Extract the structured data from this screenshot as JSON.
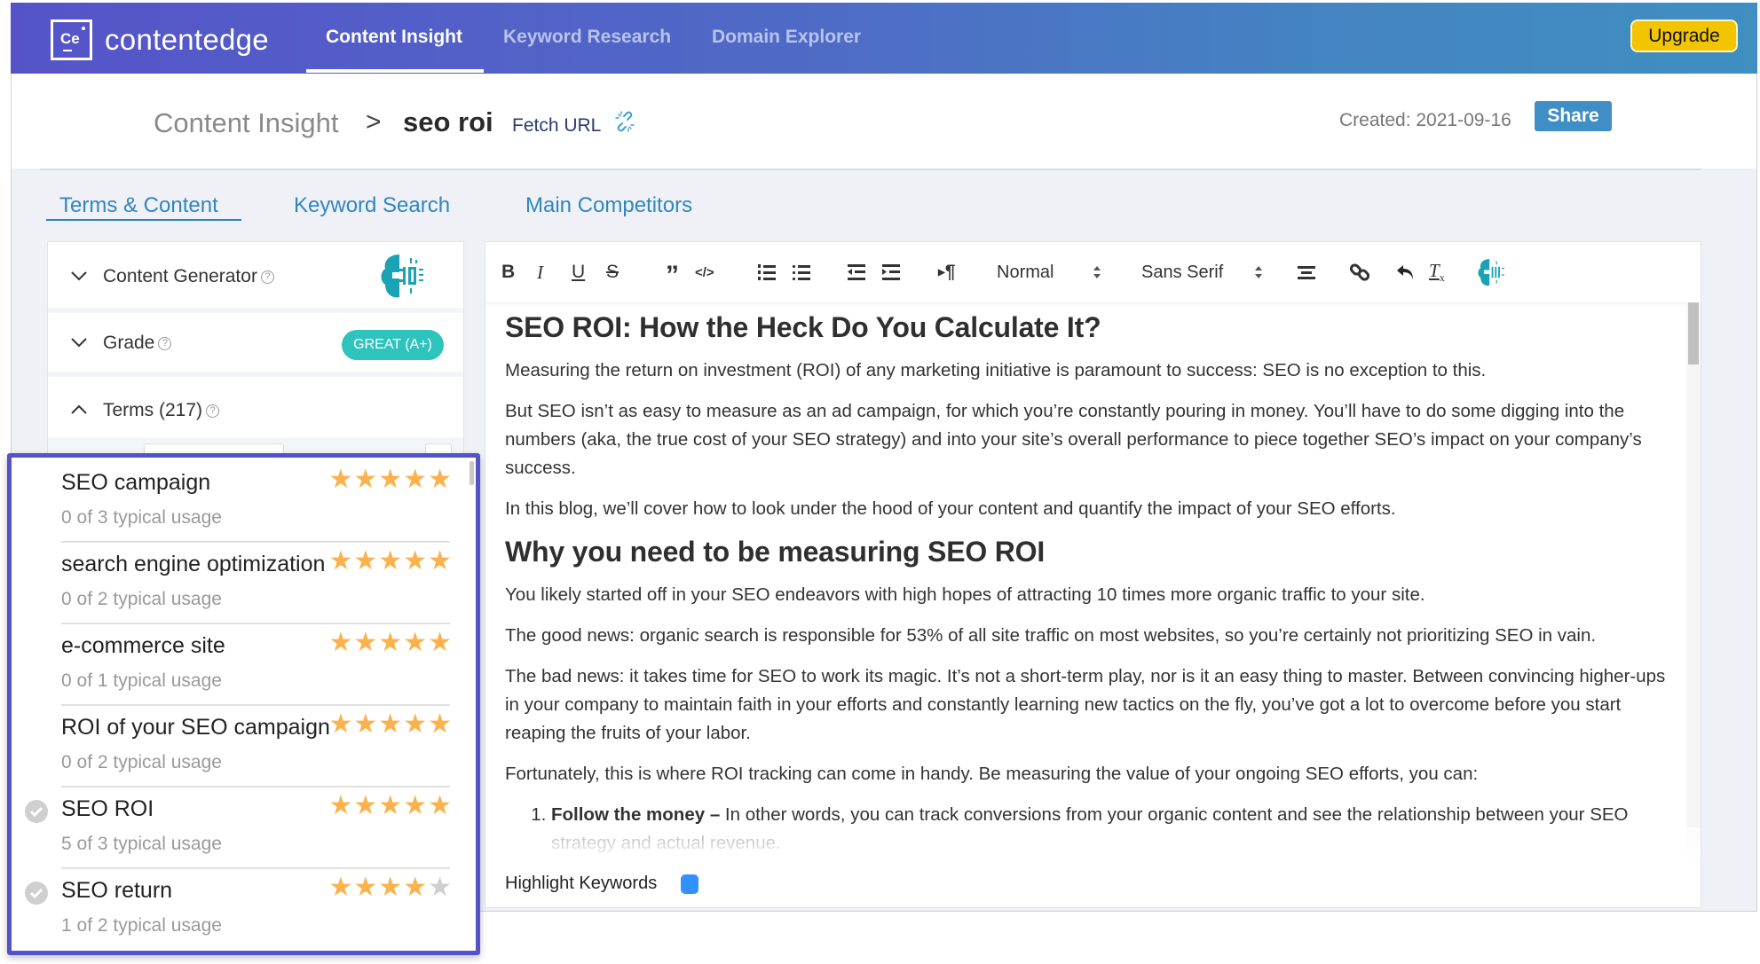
{
  "header": {
    "logo_text": "Ce",
    "brand": "contentedge",
    "nav": [
      {
        "label": "Content Insight",
        "active": true
      },
      {
        "label": "Keyword Research",
        "active": false
      },
      {
        "label": "Domain Explorer",
        "active": false
      }
    ],
    "upgrade_label": "Upgrade"
  },
  "breadcrumb": {
    "root": "Content Insight",
    "separator": ">",
    "current": "seo roi",
    "fetch_url": "Fetch URL",
    "link_icon": "broken-link-icon"
  },
  "meta": {
    "created": "Created: 2021-09-16",
    "share_label": "Share"
  },
  "tabs": [
    {
      "label": "Terms & Content",
      "active": true
    },
    {
      "label": "Keyword Search",
      "active": false
    },
    {
      "label": "Main Competitors",
      "active": false
    }
  ],
  "left_panel": {
    "content_generator": {
      "label": "Content Generator",
      "icon": "ai-brain-icon",
      "expanded": false
    },
    "grade": {
      "label": "Grade",
      "badge": "GREAT (A+)",
      "expanded": false
    },
    "terms": {
      "label": "Terms (217)",
      "expanded": true
    },
    "help_glyph": "?"
  },
  "terms": [
    {
      "name": "SEO campaign",
      "usage": "0 of 3 typical usage",
      "stars": 5,
      "used": false
    },
    {
      "name": "search engine optimization",
      "usage": "0 of 2 typical usage",
      "stars": 5,
      "used": false
    },
    {
      "name": "e-commerce site",
      "usage": "0 of 1 typical usage",
      "stars": 5,
      "used": false
    },
    {
      "name": "ROI of your SEO campaign",
      "usage": "0 of 2 typical usage",
      "stars": 5,
      "used": false
    },
    {
      "name": "SEO ROI",
      "usage": "5 of 3 typical usage",
      "stars": 5,
      "used": true
    },
    {
      "name": "SEO return",
      "usage": "1 of 2 typical usage",
      "stars": 4,
      "used": true
    }
  ],
  "toolbar": {
    "buttons": [
      "bold",
      "italic",
      "underline",
      "strike",
      "blockquote",
      "code",
      "ordered-list",
      "bullet-list",
      "outdent",
      "indent",
      "text-direction",
      "align",
      "link",
      "undo",
      "clear-format",
      "ai-assistant"
    ],
    "bold": "B",
    "italic": "I",
    "underline": "U",
    "strike": "S",
    "blockquote": "”",
    "code": "</>",
    "direction": "¶",
    "heading_select": "Normal",
    "font_select": "Sans Serif"
  },
  "editor": {
    "h1": "SEO ROI: How the Heck Do You Calculate It?",
    "p1": "Measuring the return on investment (ROI) of any marketing initiative is paramount to success: SEO is no exception to this.",
    "p2": "But SEO isn’t as easy to measure as an ad campaign, for which you’re constantly pouring in money. You’ll have to do some digging into the numbers (aka, the true cost of your SEO strategy) and into your site’s overall performance to piece together SEO’s impact on your company’s success.",
    "p3": "In this blog, we’ll cover how to look under the hood of your content and quantify the impact of your SEO efforts.",
    "h2": "Why you need to be measuring SEO ROI",
    "p4": "You likely started off in your SEO endeavors with high hopes of attracting 10 times more organic traffic to your site.",
    "p5": "The good news: organic search is responsible for 53% of all site traffic on most websites, so you’re certainly not prioritizing SEO in vain.",
    "p6": "The bad news: it takes time for SEO to work its magic. It’s not a short-term play, nor is it an easy thing to master. Between convincing higher-ups in your company to maintain faith in your efforts and constantly learning new tactics on the fly, you’ve got a lot to overcome before you start reaping the fruits of your labor.",
    "p7": "Fortunately, this is where ROI tracking can come in handy. Be measuring the value of your ongoing SEO efforts, you can:",
    "li1_bold": "Follow the money –",
    "li1_text": " In other words, you can track conversions from your organic content and see the relationship between your SEO strategy and actual revenue.",
    "highlight_label": "Highlight Keywords",
    "highlight_on": true
  },
  "colors": {
    "accent": "#2f86c0",
    "header_start": "#5653c9",
    "header_end": "#3f8fc1",
    "upgrade": "#f2c500",
    "grade_badge": "#2ec3bc",
    "star_on": "#fcb24c",
    "star_off": "#cfcfcf",
    "highlight_box": "#5452c7",
    "toggle": "#3391ff"
  }
}
